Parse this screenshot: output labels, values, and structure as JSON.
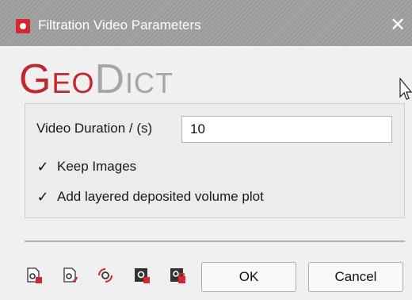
{
  "window": {
    "title": "Filtration Video Parameters",
    "close_glyph": "✕",
    "app_icon": "geodict-app-icon"
  },
  "logo": {
    "geo_first": "G",
    "geo_rest": "EO",
    "dict_first": "D",
    "dict_rest": "ICT",
    "colors": {
      "geo": "#c0282e",
      "dict": "#a6a6a6"
    }
  },
  "form": {
    "duration_label": "Video Duration / (s)",
    "duration_value": "10",
    "keep_images": {
      "label": "Keep Images",
      "checked": true
    },
    "layered_plot": {
      "label": "Add layered deposited volume plot",
      "checked": true
    },
    "check_glyph": "✓"
  },
  "toolbar": {
    "icons": [
      "settings-load-icon",
      "settings-save-icon",
      "settings-reset-icon",
      "settings-dark-icon",
      "settings-lock-icon"
    ]
  },
  "buttons": {
    "ok": "OK",
    "cancel": "Cancel"
  }
}
